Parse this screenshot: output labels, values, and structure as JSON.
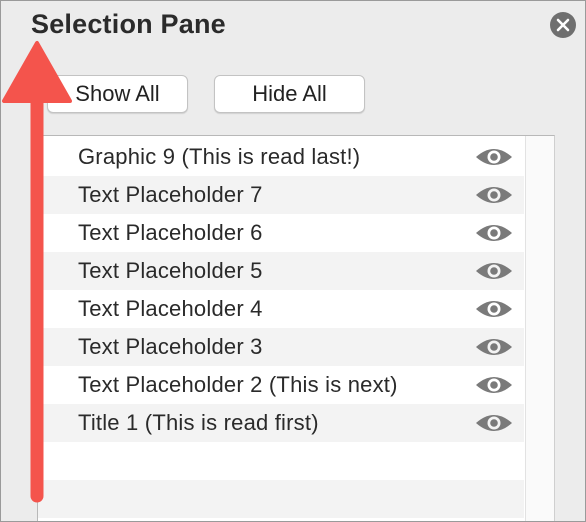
{
  "pane": {
    "title": "Selection Pane",
    "close_icon": "close-circle-icon"
  },
  "buttons": {
    "show_all": "Show All",
    "hide_all": "Hide All"
  },
  "items": [
    {
      "label": "Graphic 9 (This is read last!)",
      "icon": "eye-icon",
      "visible": true
    },
    {
      "label": "Text Placeholder 7",
      "icon": "eye-icon",
      "visible": true
    },
    {
      "label": "Text Placeholder 6",
      "icon": "eye-icon",
      "visible": true
    },
    {
      "label": "Text Placeholder 5",
      "icon": "eye-icon",
      "visible": true
    },
    {
      "label": "Text Placeholder 4",
      "icon": "eye-icon",
      "visible": true
    },
    {
      "label": "Text Placeholder 3",
      "icon": "eye-icon",
      "visible": true
    },
    {
      "label": "Text Placeholder 2 (This is next)",
      "icon": "eye-icon",
      "visible": true
    },
    {
      "label": "Title 1 (This is read first)",
      "icon": "eye-icon",
      "visible": true
    }
  ],
  "annotation": {
    "icon": "up-arrow-icon",
    "color": "#f4544c"
  },
  "colors": {
    "pane_bg": "#ececec",
    "eye": "#7a7a7a"
  }
}
